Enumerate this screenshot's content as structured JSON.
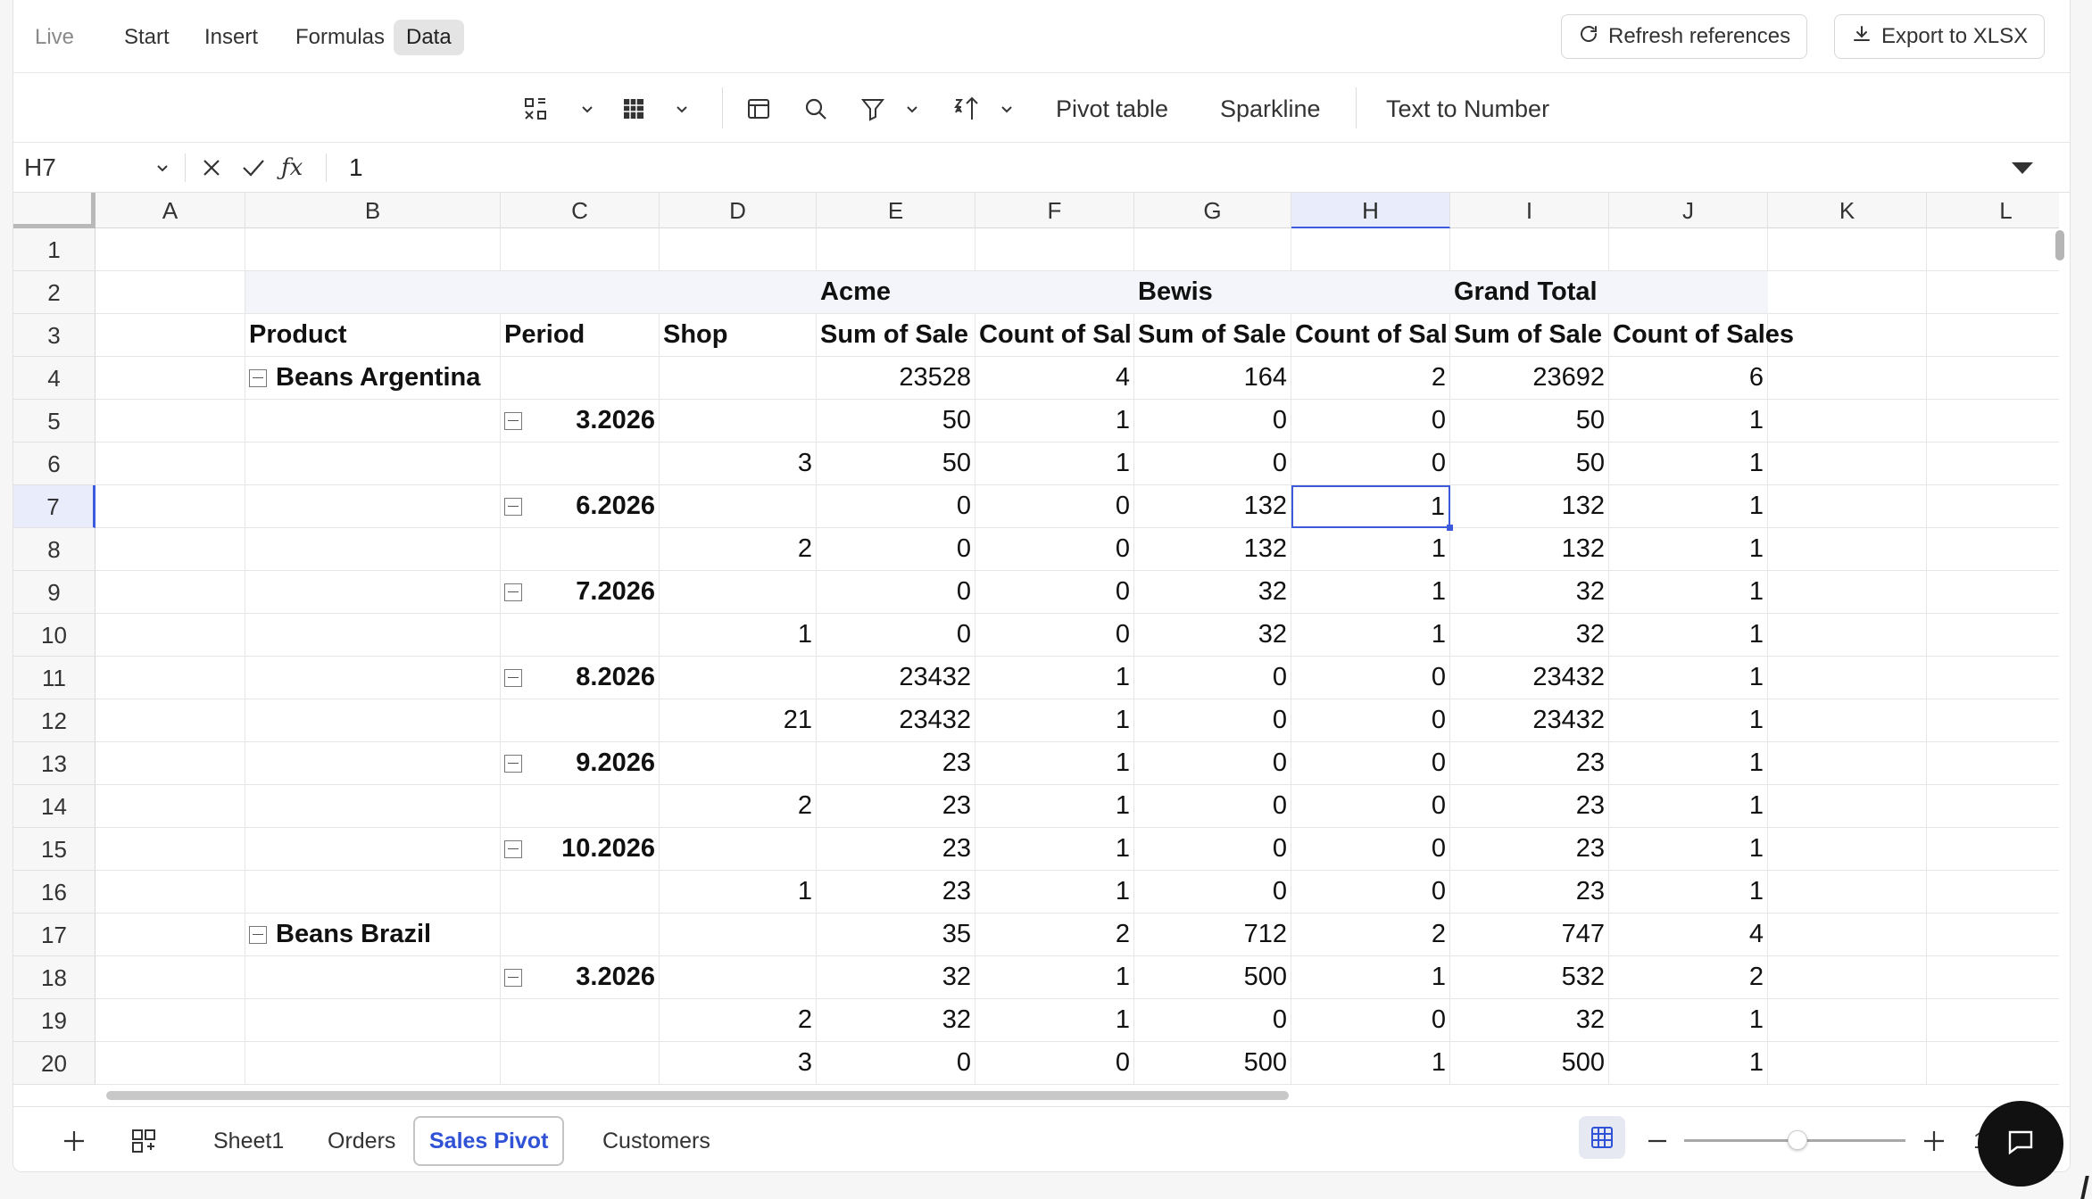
{
  "menu": {
    "items": [
      {
        "label": "Live",
        "state": "muted"
      },
      {
        "label": "Start",
        "state": "normal"
      },
      {
        "label": "Insert",
        "state": "normal"
      },
      {
        "label": "Formulas",
        "state": "normal"
      },
      {
        "label": "Data",
        "state": "active"
      }
    ],
    "refresh_label": "Refresh references",
    "export_label": "Export to XLSX"
  },
  "toolbar": {
    "icons": [
      "select-icon",
      "table-style-icon",
      "table-icon",
      "search-icon",
      "filter-icon",
      "sort-icon"
    ],
    "pivot_label": "Pivot table",
    "sparkline_label": "Sparkline",
    "text_to_number_label": "Text to Number"
  },
  "formula_bar": {
    "cell_ref": "H7",
    "value": "1"
  },
  "columns": [
    "A",
    "B",
    "C",
    "D",
    "E",
    "F",
    "G",
    "H",
    "I",
    "J",
    "K",
    "L"
  ],
  "selected_column": "H",
  "selected_row": 7,
  "rows": [
    1,
    2,
    3,
    4,
    5,
    6,
    7,
    8,
    9,
    10,
    11,
    12,
    13,
    14,
    15,
    16,
    17,
    18,
    19,
    20
  ],
  "pivot": {
    "group_headers": {
      "acme": "Acme",
      "bewis": "Bewis",
      "grand_total": "Grand Total"
    },
    "column_headers": [
      "Product",
      "Period",
      "Shop",
      "Sum of Sale",
      "Count of Sal",
      "Sum of Sale",
      "Count of Sal",
      "Sum of Sale",
      "Count of Sales"
    ],
    "data_rows": [
      {
        "product": "Beans Argentina",
        "period": "",
        "shop": "",
        "values": [
          "23528",
          "4",
          "164",
          "2",
          "23692",
          "6"
        ]
      },
      {
        "product": "",
        "period": "3.2026",
        "shop": "",
        "values": [
          "50",
          "1",
          "0",
          "0",
          "50",
          "1"
        ]
      },
      {
        "product": "",
        "period": "",
        "shop": "3",
        "values": [
          "50",
          "1",
          "0",
          "0",
          "50",
          "1"
        ]
      },
      {
        "product": "",
        "period": "6.2026",
        "shop": "",
        "values": [
          "0",
          "0",
          "132",
          "1",
          "132",
          "1"
        ]
      },
      {
        "product": "",
        "period": "",
        "shop": "2",
        "values": [
          "0",
          "0",
          "132",
          "1",
          "132",
          "1"
        ]
      },
      {
        "product": "",
        "period": "7.2026",
        "shop": "",
        "values": [
          "0",
          "0",
          "32",
          "1",
          "32",
          "1"
        ]
      },
      {
        "product": "",
        "period": "",
        "shop": "1",
        "values": [
          "0",
          "0",
          "32",
          "1",
          "32",
          "1"
        ]
      },
      {
        "product": "",
        "period": "8.2026",
        "shop": "",
        "values": [
          "23432",
          "1",
          "0",
          "0",
          "23432",
          "1"
        ]
      },
      {
        "product": "",
        "period": "",
        "shop": "21",
        "values": [
          "23432",
          "1",
          "0",
          "0",
          "23432",
          "1"
        ]
      },
      {
        "product": "",
        "period": "9.2026",
        "shop": "",
        "values": [
          "23",
          "1",
          "0",
          "0",
          "23",
          "1"
        ]
      },
      {
        "product": "",
        "period": "",
        "shop": "2",
        "values": [
          "23",
          "1",
          "0",
          "0",
          "23",
          "1"
        ]
      },
      {
        "product": "",
        "period": "10.2026",
        "shop": "",
        "values": [
          "23",
          "1",
          "0",
          "0",
          "23",
          "1"
        ]
      },
      {
        "product": "",
        "period": "",
        "shop": "1",
        "values": [
          "23",
          "1",
          "0",
          "0",
          "23",
          "1"
        ]
      },
      {
        "product": "Beans Brazil",
        "period": "",
        "shop": "",
        "values": [
          "35",
          "2",
          "712",
          "2",
          "747",
          "4"
        ]
      },
      {
        "product": "",
        "period": "3.2026",
        "shop": "",
        "values": [
          "32",
          "1",
          "500",
          "1",
          "532",
          "2"
        ]
      },
      {
        "product": "",
        "period": "",
        "shop": "2",
        "values": [
          "32",
          "1",
          "0",
          "0",
          "32",
          "1"
        ]
      },
      {
        "product": "",
        "period": "",
        "shop": "3",
        "values": [
          "0",
          "0",
          "500",
          "1",
          "500",
          "1"
        ]
      }
    ]
  },
  "sheets": {
    "tabs": [
      {
        "label": "Sheet1",
        "active": false
      },
      {
        "label": "Orders",
        "active": false
      },
      {
        "label": "Sales Pivot",
        "active": true
      },
      {
        "label": "Customers",
        "active": false
      }
    ]
  },
  "zoom": {
    "label": "10",
    "level_fraction": 0.5
  },
  "colors": {
    "accent": "#3b5bdb",
    "active_tab": "#2f52d6",
    "pivot_header_bg": "#f3f5fa"
  }
}
